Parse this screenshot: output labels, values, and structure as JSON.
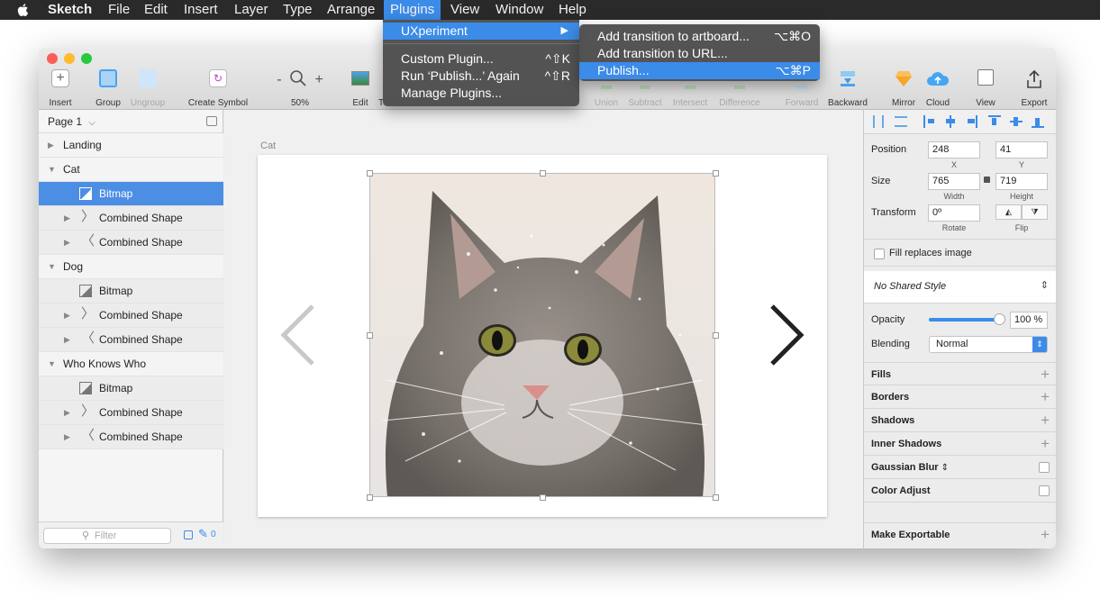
{
  "menubar": {
    "app": "Sketch",
    "items": [
      "File",
      "Edit",
      "Insert",
      "Layer",
      "Type",
      "Arrange",
      "Plugins",
      "View",
      "Window",
      "Help"
    ]
  },
  "plugins_menu": {
    "items": [
      {
        "label": "UXperiment",
        "shortcut": "▶"
      },
      {
        "label": "Custom Plugin...",
        "shortcut": "^⇧K"
      },
      {
        "label": "Run ‘Publish...’ Again",
        "shortcut": "^⇧R"
      },
      {
        "label": "Manage Plugins..."
      }
    ]
  },
  "submenu": {
    "items": [
      {
        "label": "Add transition to artboard...",
        "shortcut": "⌥⌘O"
      },
      {
        "label": "Add transition to URL..."
      },
      {
        "label": "Publish...",
        "shortcut": "⌥⌘P"
      }
    ]
  },
  "toolbar": {
    "insert": "Insert",
    "group": "Group",
    "ungroup": "Ungroup",
    "create_symbol": "Create Symbol",
    "zoom": "50%",
    "edit": "Edit",
    "transforms": "T",
    "union": "Union",
    "subtract": "Subtract",
    "intersect": "Intersect",
    "difference": "Difference",
    "forward": "Forward",
    "backward": "Backward",
    "mirror": "Mirror",
    "cloud": "Cloud",
    "view": "View",
    "export": "Export",
    "zoom_minus": "-",
    "zoom_plus": "+"
  },
  "layers": {
    "page": "Page 1",
    "rows": [
      "Landing",
      "Cat",
      "Bitmap",
      "Combined Shape",
      "Combined Shape",
      "Dog",
      "Bitmap",
      "Combined Shape",
      "Combined Shape",
      "Who Knows Who",
      "Bitmap",
      "Combined Shape",
      "Combined Shape"
    ],
    "filter_placeholder": "Filter",
    "count": "0"
  },
  "canvas": {
    "artboard_name": "Cat"
  },
  "inspector": {
    "position_label": "Position",
    "x": "248",
    "y": "41",
    "x_label": "X",
    "y_label": "Y",
    "size_label": "Size",
    "width": "765",
    "height": "719",
    "width_label": "Width",
    "height_label": "Height",
    "transform_label": "Transform",
    "rotate": "0º",
    "rotate_label": "Rotate",
    "flip_label": "Flip",
    "fill_replaces": "Fill replaces image",
    "shared_style": "No Shared Style",
    "opacity_label": "Opacity",
    "opacity": "100 %",
    "opacity_level": 1.0,
    "blending_label": "Blending",
    "blending": "Normal",
    "sections": [
      "Fills",
      "Borders",
      "Shadows",
      "Inner Shadows",
      "Gaussian Blur",
      "Color Adjust"
    ],
    "make_exportable": "Make Exportable"
  },
  "colors": {
    "accent": "#3b8be8",
    "selection": "#4b8ee4"
  }
}
